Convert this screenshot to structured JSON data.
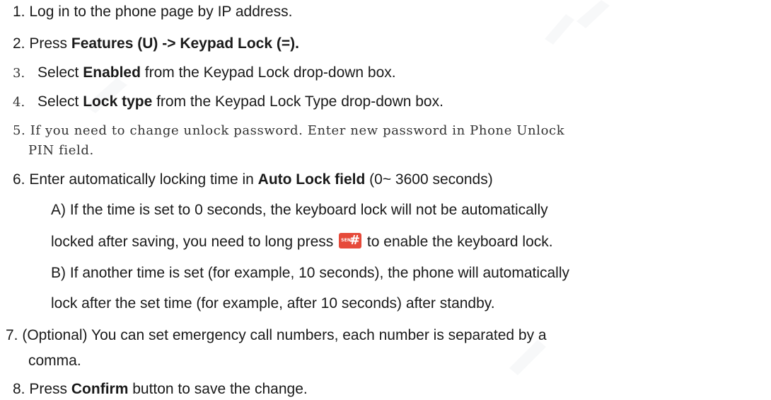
{
  "steps": {
    "s1": "1. Log in to the phone page by IP address.",
    "s2_pre": "2. Press ",
    "s2_bold": "Features (U) -> Keypad Lock (=).",
    "s3_num": "3.",
    "s3_pre": "Select ",
    "s3_bold": "Enabled",
    "s3_post": " from the Keypad Lock drop-down box.",
    "s4_num": "4.",
    "s4_pre": "Select ",
    "s4_bold": "Lock type",
    "s4_post": " from the Keypad Lock Type drop-down box.",
    "s5_line1": "5. If you need to change unlock password. Enter new password in Phone Unlock",
    "s5_line2": "PIN field.",
    "s6_pre": "6. Enter automatically locking time in ",
    "s6_bold": "Auto Lock field",
    "s6_post": " (0~ 3600 seconds)",
    "s6a_line1": "A)  If the time is set to 0 seconds, the keyboard lock will not be automatically",
    "s6a_line2_pre": "locked after saving, you need to long press ",
    "s6a_line2_post": " to enable the keyboard lock.",
    "s6b_line1": "B)  If another time is set (for example, 10 seconds), the phone will automatically",
    "s6b_line2": "lock after the set time (for example, after 10 seconds) after standby.",
    "s7_line1": "7. (Optional) You can set emergency call numbers, each number is separated by a",
    "s7_line2": "comma.",
    "s8_pre": "8. Press ",
    "s8_bold": "Confirm",
    "s8_post": " button to save the change."
  },
  "key_icon": {
    "name": "send-hash-key-icon",
    "send_text": "SEND",
    "hash_text": "#",
    "color": "#e64a3a"
  },
  "colors": {
    "text": "#1a1a1a",
    "watermark": "#9aa5b5"
  }
}
